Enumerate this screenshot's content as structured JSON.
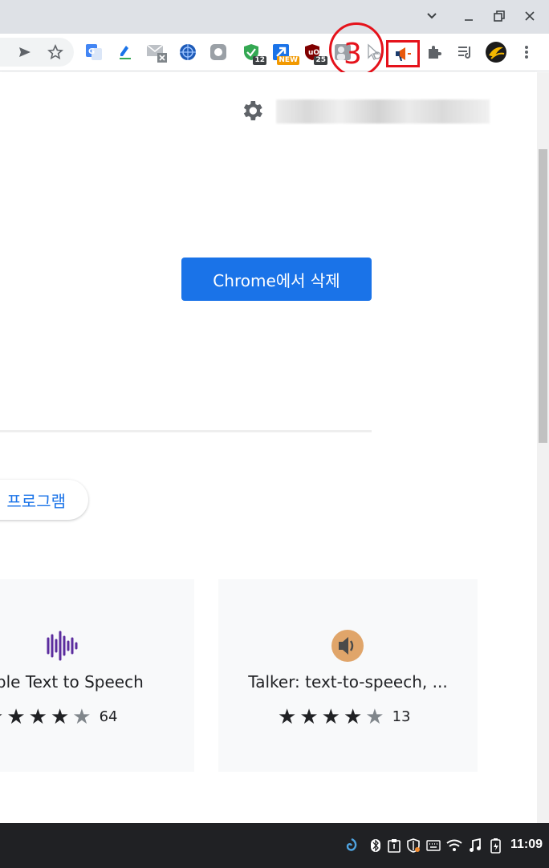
{
  "window": {
    "controls": [
      "chevron-down",
      "minimize",
      "restore",
      "close"
    ]
  },
  "toolbar": {
    "extensions": [
      {
        "name": "google-translate-icon",
        "badge": ""
      },
      {
        "name": "pen-extension-icon",
        "badge": ""
      },
      {
        "name": "mail-checker-icon",
        "badge": ""
      },
      {
        "name": "globe-extension-icon",
        "badge": ""
      },
      {
        "name": "gray-extension-icon",
        "badge": ""
      },
      {
        "name": "shield-check-icon",
        "badge": "12"
      },
      {
        "name": "arrow-extension-icon",
        "badge": "NEW"
      },
      {
        "name": "ublock-icon",
        "badge": "25"
      },
      {
        "name": "gray-person-icon",
        "badge": ""
      },
      {
        "name": "cursor-extension-icon",
        "badge": ""
      },
      {
        "name": "megaphone-extension-icon",
        "badge": ""
      }
    ],
    "step_annotation": "3"
  },
  "main": {
    "remove_button": "Chrome에서 삭제",
    "pill_label": "프로그램",
    "cards": [
      {
        "title": "nple Text to Speech",
        "rating": 4,
        "count": "64"
      },
      {
        "title": "Talker: text-to-speech, ...",
        "rating": 4,
        "count": "13"
      }
    ]
  },
  "taskbar": {
    "time": "11:09"
  },
  "colors": {
    "accent": "#1a73e8",
    "annotation_red": "#e5121b"
  }
}
